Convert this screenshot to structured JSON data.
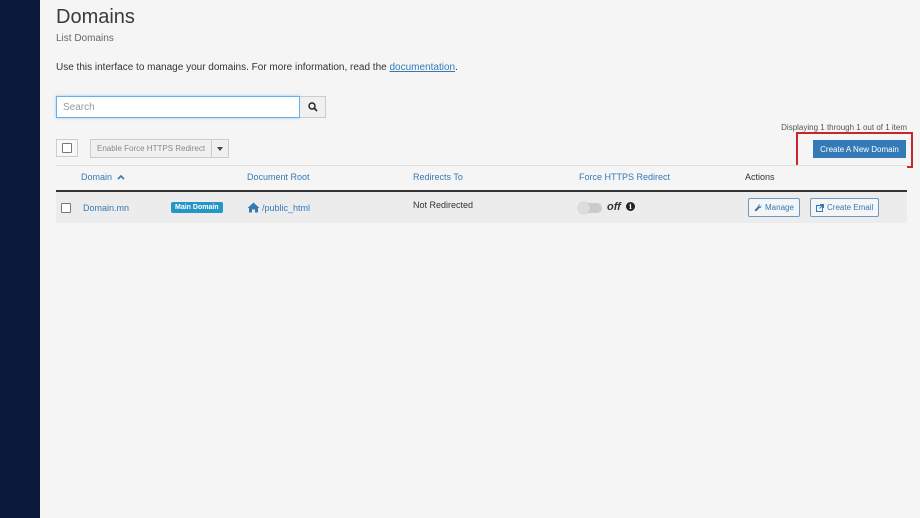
{
  "page": {
    "title": "Domains",
    "subtitle": "List Domains",
    "description": "Use this interface to manage your domains. For more information, read the",
    "doc_link": "documentation",
    "period": "."
  },
  "search": {
    "placeholder": "Search",
    "value": ""
  },
  "toolbar": {
    "https_label": "Enable Force HTTPS Redirect",
    "create_label": "Create A New Domain",
    "displaying": "Displaying 1 through 1 out of 1 item"
  },
  "table": {
    "headers": [
      "Domain",
      "Document Root",
      "Redirects To",
      "Force HTTPS Redirect",
      "Actions"
    ],
    "rows": [
      {
        "domain": "Domain.mn",
        "badge": "Main Domain",
        "doc_root": "/public_html",
        "redirects_to": "Not Redirected",
        "https_state": "off",
        "manage": "Manage",
        "create_email": "Create Email"
      }
    ]
  },
  "colors": {
    "sidebar": "#0b1a3a",
    "accent": "#337ab7",
    "badge": "#2596c8",
    "highlight": "#c9262c"
  },
  "icons": [
    "search-icon",
    "caret-down-icon",
    "sort-up-icon",
    "home-icon",
    "info-icon",
    "wrench-icon",
    "external-link-icon"
  ]
}
